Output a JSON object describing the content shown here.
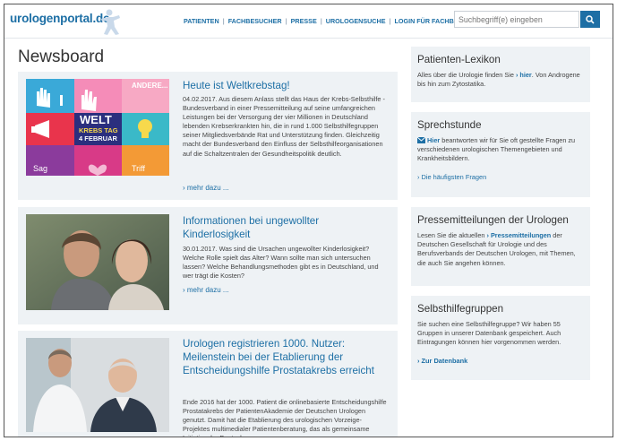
{
  "header": {
    "logo": "urologenportal.de",
    "nav": [
      "PATIENTEN",
      "FACHBESUCHER",
      "PRESSE",
      "UROLOGENSUCHE",
      "LOGIN FÜR FACHBESUCHER"
    ],
    "search_placeholder": "Suchbegriff(e) eingeben",
    "search_icon": "search-icon"
  },
  "main": {
    "title": "Newsboard",
    "more_label": "› mehr dazu ...",
    "articles": [
      {
        "headline": "Heute ist Weltkrebstag!",
        "text": "04.02.2017. Aus diesem Anlass stellt das Haus der Krebs-Selbsthilfe - Bundesverband in einer Pressemitteilung auf seine umfangreichen Leistungen bei der Versorgung der vier Millionen in Deutschland lebenden Krebserkrankten hin, die in rund 1.000 Selbsthilfegruppen seiner Mitgliedsverbände Rat und Unterstützung finden. Gleichzeitig macht der Bundesverband den Einfluss der Selbsthilfeorganisationen auf die Schaltzentralen der Gesundheitspolitik deutlich.",
        "image_lines": [
          "WELT",
          "KREBS TAG",
          "4 FEBRUAR"
        ],
        "image_words": [
          "ANDERE...",
          "Sag",
          "Triff"
        ]
      },
      {
        "headline": "Informationen bei ungewollter Kinderlosigkeit",
        "text": "30.01.2017. Was sind die Ursachen ungewollter Kinderlosigkeit? Welche Rolle spielt das Alter? Wann sollte man sich untersuchen lassen? Welche Behandlungsmethoden gibt es in Deutschland, und wer trägt die Kosten?"
      },
      {
        "headline": "Urologen registrieren 1000. Nutzer: Meilenstein bei der Etablierung der Entscheidungshilfe Prostatakrebs erreicht",
        "text": "Ende 2016 hat der 1000. Patient die onlinebasierte Entscheidungshilfe Prostatakrebs der PatientenAkademie der Deutschen Urologen genutzt. Damit hat die Etablierung des urologischen Vorzeige-Projektes multimedialer Patientenberatung, das als gemeinsame Initiative der Deutschen"
      }
    ]
  },
  "sidebar": {
    "lexikon": {
      "title": "Patienten-Lexikon",
      "text_before": "Alles über die Urologie finden Sie ",
      "link": "› hier",
      "text_after": ". Von Androgene bis hin zum Zytostatika."
    },
    "sprechstunde": {
      "title": "Sprechstunde",
      "link": "Hier",
      "text": " beantworten wir für Sie oft gestellte Fragen zu verschiedenen urologischen Themengebieten und Krankheitsbildern.",
      "faq": "› Die häufigsten Fragen",
      "icon": "mail-icon"
    },
    "presse": {
      "title": "Pressemitteilungen der Urologen",
      "text_before": "Lesen Sie die aktuellen ",
      "link": "› Pressemitteilungen",
      "text_after": " der Deutschen Gesellschaft für Urologie und des Berufsverbands der Deutschen Urologen, mit Themen, die auch Sie angehen können."
    },
    "selbsthilfe": {
      "title": "Selbsthilfegruppen",
      "text": "Sie suchen eine Selbsthilfegruppe? Wir haben 55 Gruppen in unserer Datenbank gespeichert. Auch Eintragungen können hier vorgenommen werden.",
      "link": "› Zur Datenbank"
    }
  }
}
